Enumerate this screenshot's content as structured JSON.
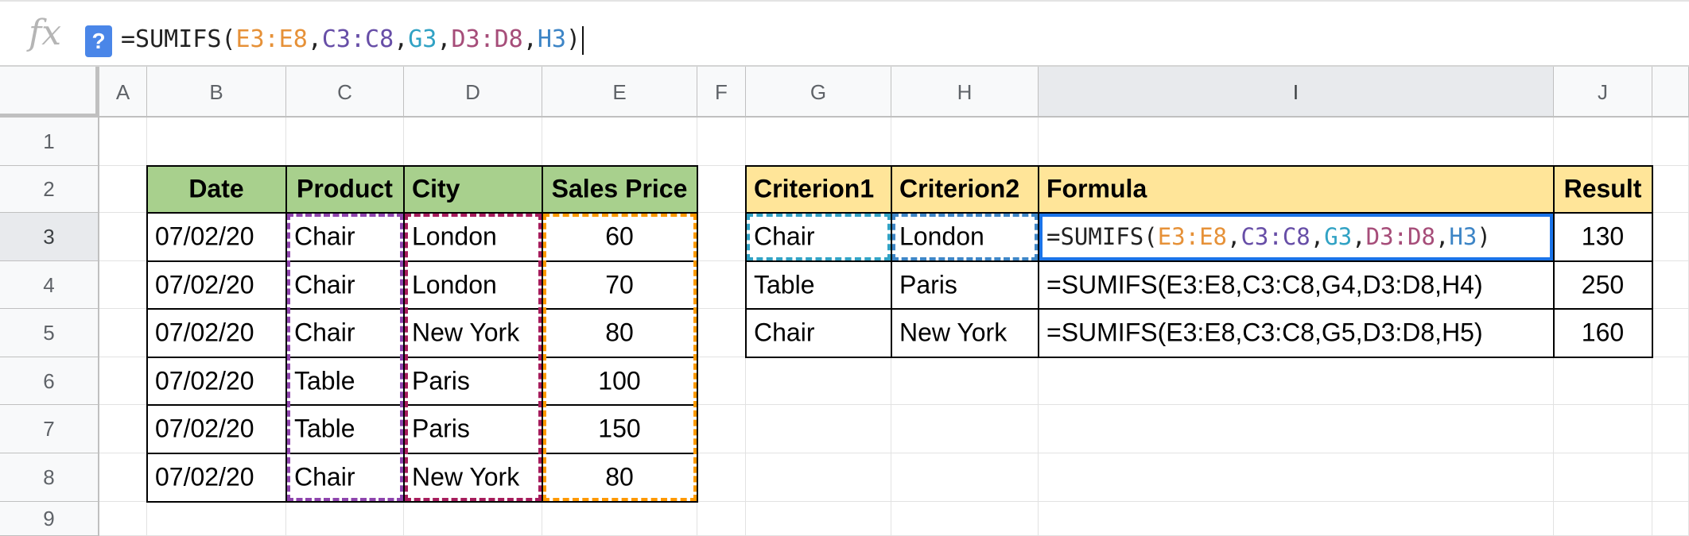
{
  "formula_bar": {
    "fx_label": "fx",
    "help_label": "?",
    "formula_parts": [
      {
        "text": "=SUMIFS(",
        "color": "#222222"
      },
      {
        "text": "E3:E8",
        "color": "#e69138"
      },
      {
        "text": ",",
        "color": "#222222"
      },
      {
        "text": "C3:C8",
        "color": "#674ea7"
      },
      {
        "text": ",",
        "color": "#222222"
      },
      {
        "text": "G3",
        "color": "#31a2c4"
      },
      {
        "text": ",",
        "color": "#222222"
      },
      {
        "text": "D3:D8",
        "color": "#a64d79"
      },
      {
        "text": ",",
        "color": "#222222"
      },
      {
        "text": "H3",
        "color": "#3d85c6"
      },
      {
        "text": ")",
        "color": "#222222"
      }
    ]
  },
  "columns": [
    "A",
    "B",
    "C",
    "D",
    "E",
    "F",
    "G",
    "H",
    "I",
    "J"
  ],
  "rows": [
    "1",
    "2",
    "3",
    "4",
    "5",
    "6",
    "7",
    "8",
    "9"
  ],
  "selected_cell": "I3",
  "left_table": {
    "headers": [
      "Date",
      "Product",
      "City",
      "Sales Price"
    ],
    "rows": [
      [
        "07/02/20",
        "Chair",
        "London",
        "60"
      ],
      [
        "07/02/20",
        "Chair",
        "London",
        "70"
      ],
      [
        "07/02/20",
        "Chair",
        "New York",
        "80"
      ],
      [
        "07/02/20",
        "Table",
        "Paris",
        "100"
      ],
      [
        "07/02/20",
        "Table",
        "Paris",
        "150"
      ],
      [
        "07/02/20",
        "Chair",
        "New York",
        "80"
      ]
    ],
    "header_color": "#a8d08d"
  },
  "right_table": {
    "headers": [
      "Criterion1",
      "Criterion2",
      "Formula",
      "Result"
    ],
    "rows": [
      [
        "Chair",
        "London",
        "=SUMIFS(E3:E8,C3:C8,G3,D3:D8,H3)",
        "130"
      ],
      [
        "Table",
        "Paris",
        "=SUMIFS(E3:E8,C3:C8,G4,D3:D8,H4)",
        "250"
      ],
      [
        "Chair",
        "New York",
        "=SUMIFS(E3:E8,C3:C8,G5,D3:D8,H5)",
        "160"
      ]
    ],
    "header_color": "#ffe599"
  },
  "range_colors": {
    "E3:E8": "#ff9900",
    "C3:C8": "#8e44ad",
    "D3:D8": "#a61c5c",
    "G3": "#31a2c4",
    "H3": "#3d85c6",
    "selection": "#1a73e8"
  }
}
